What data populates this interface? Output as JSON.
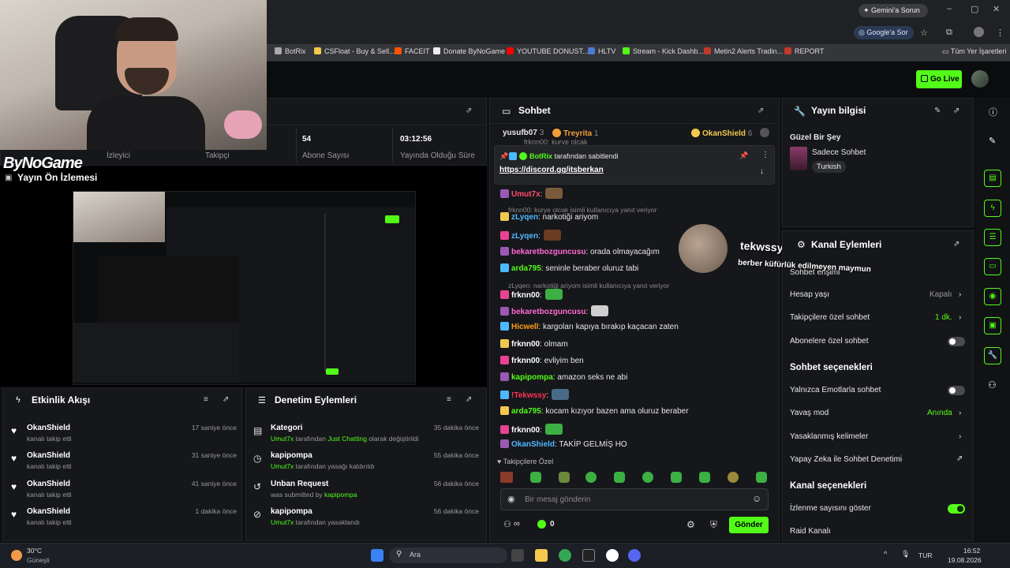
{
  "browser": {
    "gemini_label": "Gemini'a Sorun",
    "google_ask_label": "Google'a Sor",
    "bookmarks": [
      "BotRix",
      "CSFloat - Buy & Sell...",
      "FACEIT",
      "Donate ByNoGame",
      "YOUTUBE DONUST...",
      "HLTV",
      "Stream - Kick Dashb...",
      "Metin2 Alerts Tradin...",
      "REPORT"
    ],
    "all_bookmarks": "Tüm Yer İşaretleri"
  },
  "topbar": {
    "go_live": "Go Live"
  },
  "stats": {
    "viewers_label": "İzleyici",
    "followers_label": "Takipçi",
    "subs_value": "54",
    "subs_label": "Abone Sayısı",
    "uptime_value": "03:12:56",
    "uptime_label": "Yayında Olduğu Süre"
  },
  "preview": {
    "logo": "ByNoGame",
    "title": "Yayın Ön İzlemesi"
  },
  "activity": {
    "title": "Etkinlik Akışı",
    "items": [
      {
        "name": "OkanShield",
        "sub": "kanalı takip etti",
        "time": "17 saniye önce"
      },
      {
        "name": "OkanShield",
        "sub": "kanalı takip etti",
        "time": "31 saniye önce"
      },
      {
        "name": "OkanShield",
        "sub": "kanalı takip etti",
        "time": "41 saniye önce"
      },
      {
        "name": "OkanShield",
        "sub": "kanalı takip etti",
        "time": "1 dakika önce"
      }
    ]
  },
  "mod": {
    "title": "Denetim Eylemleri",
    "items": [
      {
        "title": "Kategori",
        "user": "Umut7x",
        "mid": " tarafından ",
        "obj": "Just Chatting",
        "end": " olarak değiştirildi",
        "time": "35 dakika önce"
      },
      {
        "title": "kapipompa",
        "user": "Umut7x",
        "mid": " tarafından yasağı kaldırıldı",
        "obj": "",
        "end": "",
        "time": "55 dakika önce"
      },
      {
        "title": "Unban Request",
        "user": "",
        "mid": "was submitted by ",
        "obj": "kapipompa",
        "end": "",
        "time": "56 dakika önce"
      },
      {
        "title": "kapipompa",
        "user": "Umut7x",
        "mid": " tarafından yasaklandı",
        "obj": "",
        "end": "",
        "time": "56 dakika önce"
      }
    ]
  },
  "chat": {
    "title": "Sohbet",
    "top_gifters": [
      {
        "name": "yusufb07",
        "count": "3"
      },
      {
        "name": "Treyrita",
        "count": "1"
      },
      {
        "name": "OkanShield",
        "count": "6"
      }
    ],
    "peek": "frknn00: kurye olcak",
    "pinned_by": "BotRix",
    "pinned_suffix": "tarafından sabitlendi",
    "pinned_link": "https://discord.gg/itsberkan",
    "messages": [
      {
        "user": "Umut7x",
        "color": "#ff4d6d",
        "text": ":",
        "emote": "#7a5a3c"
      },
      {
        "reply": "frknn00: kurye olcak isimli kullanıcıya yanıt veriyor"
      },
      {
        "user": "zLyqen",
        "color": "#4db8ff",
        "text": ": narkotiği ariyom"
      },
      {
        "user": "zLyqen",
        "color": "#4db8ff",
        "text": ":",
        "emote": "#6b3c22"
      },
      {
        "user": "bekaretbozguncusu",
        "color": "#ff6ad5",
        "text": ": orada olmayacağım"
      },
      {
        "user": "arda795",
        "color": "#53fc18",
        "text": ": seninle beraber oluruz tabi"
      },
      {
        "reply": "zLyqen: narkotiği ariyom isimli kullanıcıya yanıt veriyor"
      },
      {
        "user": "frknn00",
        "color": "#ffffff",
        "text": ":",
        "emote": "#3cb043"
      },
      {
        "user": "bekaretbozguncusu",
        "color": "#ff6ad5",
        "text": ":",
        "emote": "#cfcfcf"
      },
      {
        "user": "Hicwell",
        "color": "#ff9f1a",
        "text": ": kargoları kapıya bırakıp kaçacan zaten"
      },
      {
        "user": "frknn00",
        "color": "#ffffff",
        "text": ": olmam"
      },
      {
        "user": "frknn00",
        "color": "#ffffff",
        "text": ": evliyim ben"
      },
      {
        "user": "kapipompa",
        "color": "#53fc18",
        "text": ": amazon seks ne abi"
      },
      {
        "user": "!Tekwssy",
        "color": "#ff3355",
        "text": ":",
        "emote": "#4a6a8a"
      },
      {
        "user": "arda795",
        "color": "#53fc18",
        "text": ": kocam kızıyor bazen ama oluruz beraber"
      },
      {
        "user": "frknn00",
        "color": "#ffffff",
        "text": ":",
        "emote": "#3cb043"
      },
      {
        "user": "OkanShield",
        "color": "#4db8ff",
        "text": ": TAKİP GELMİŞ HO"
      }
    ],
    "followers_only": "Takipçilere Özel",
    "input_placeholder": "Bir mesaj gönderin",
    "points": "0",
    "send": "Gönder"
  },
  "overlay": {
    "title": "tekwssy shared!",
    "sub": "berber küfürlük edilmeyen maymun"
  },
  "stream_info": {
    "title": "Yayın bilgisi",
    "stream_title": "Güzel Bir Şey",
    "category": "Sadece Sohbet",
    "tag": "Turkish"
  },
  "channel_actions": {
    "title": "Kanal Eylemleri",
    "rows": [
      {
        "label": "Sohbet erişimi",
        "value": ""
      },
      {
        "label": "Hesap yaşı",
        "value": "Kapalı"
      },
      {
        "label": "Takipçilere özel sohbet",
        "value": "1 dk."
      },
      {
        "label": "Abonelere özel sohbet",
        "value": ""
      }
    ],
    "chat_options_title": "Sohbet seçenekleri",
    "chat_options": [
      {
        "label": "Yalnızca Emotlarla sohbet",
        "value": ""
      },
      {
        "label": "Yavaş mod",
        "value": "Anında"
      },
      {
        "label": "Yasaklanmış kelimeler",
        "value": ""
      },
      {
        "label": "Yapay Zeka ile Sohbet Denetimi",
        "value": ""
      }
    ],
    "channel_options_title": "Kanal seçenekleri",
    "channel_options": [
      {
        "label": "İzlenme sayısını göster"
      },
      {
        "label": "Raid Kanalı"
      }
    ]
  },
  "taskbar": {
    "temp": "30°C",
    "weather": "Güneşli",
    "search": "Ara",
    "lang": "TUR",
    "time": "16:52",
    "date": "19.08.2026"
  },
  "colors": {
    "accent": "#53fc18",
    "bg": "#0f1012",
    "panel": "#16171a"
  }
}
